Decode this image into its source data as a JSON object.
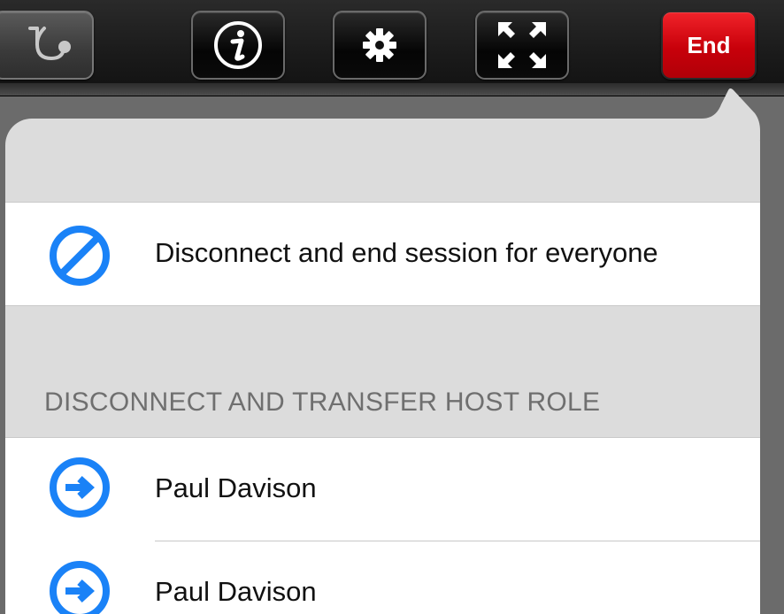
{
  "toolbar": {
    "buttons": [
      {
        "icon": "stethoscope-icon"
      },
      {
        "icon": "info-icon"
      },
      {
        "icon": "gear-icon"
      },
      {
        "icon": "fullscreen-icon"
      }
    ],
    "end_label": "End"
  },
  "menu": {
    "end_for_all": {
      "label": "Disconnect and end session for everyone",
      "icon": "prohibited-icon"
    },
    "transfer_section_header": "DISCONNECT AND TRANSFER HOST ROLE",
    "participants": [
      {
        "name": "Paul Davison",
        "icon": "arrow-right-circle-icon"
      },
      {
        "name": "Paul Davison",
        "icon": "arrow-right-circle-icon"
      }
    ]
  },
  "colors": {
    "accent": "#1a82f7",
    "end_red": "#d8000c",
    "toolbar_bg": "#1b1b1b",
    "popover_bg": "#dcdcdc"
  }
}
